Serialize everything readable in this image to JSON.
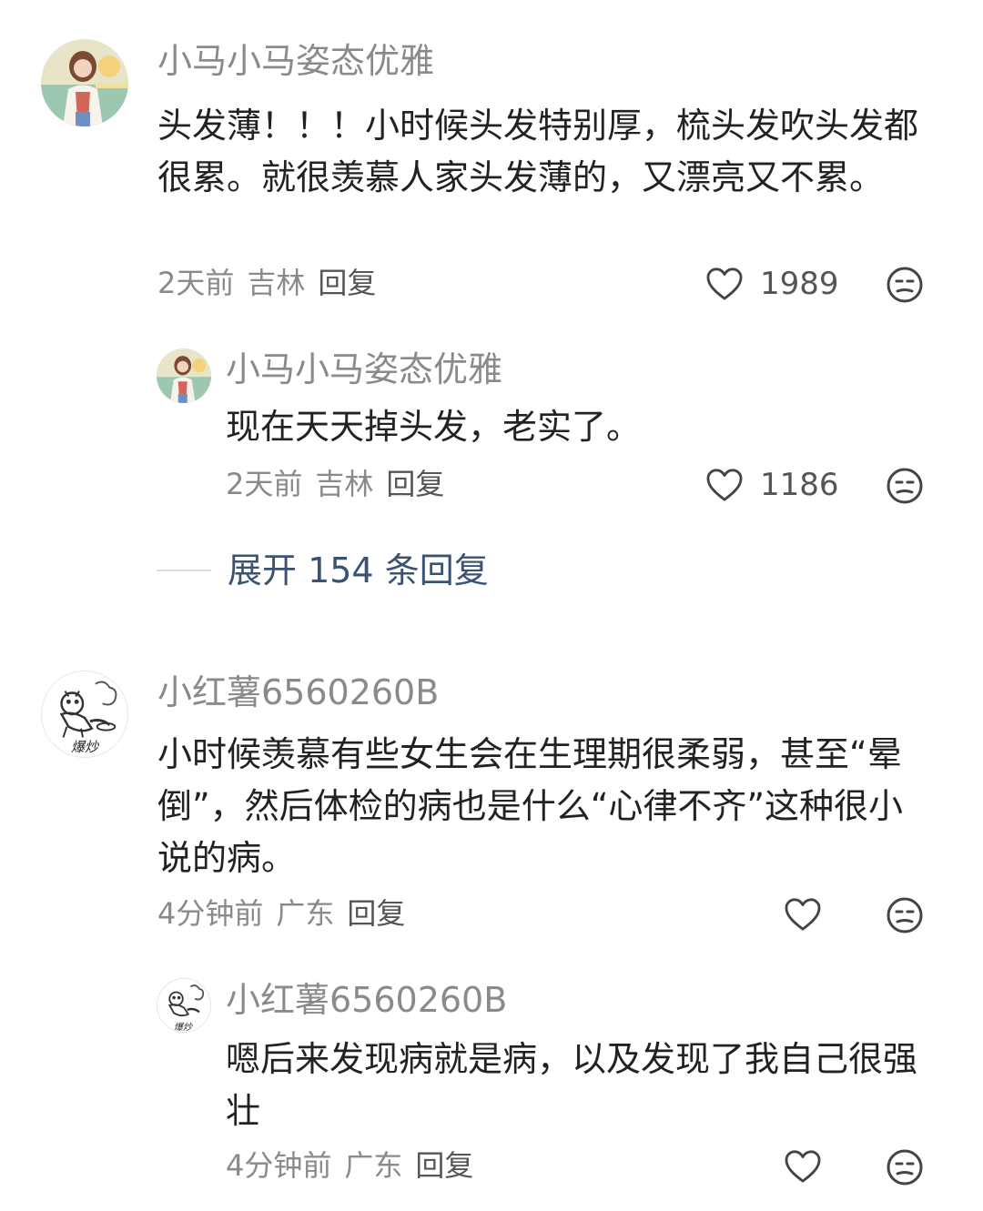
{
  "comments": [
    {
      "username": "小马小马姿态优雅",
      "text": "头发薄！！！小时候头发特别厚，梳头发吹头发都很累。就很羡慕人家头发薄的，又漂亮又不累。",
      "time": "2天前",
      "location": "吉林",
      "reply_label": "回复",
      "likes": "1989",
      "avatar": "girl-avatar",
      "reply": {
        "username": "小马小马姿态优雅",
        "text": "现在天天掉头发，老实了。",
        "time": "2天前",
        "location": "吉林",
        "reply_label": "回复",
        "likes": "1186",
        "avatar": "girl-avatar"
      },
      "expand_label": "展开 154 条回复"
    },
    {
      "username": "小红薯6560260B",
      "text": "小时候羡慕有些女生会在生理期很柔弱，甚至“晕倒”，然后体检的病也是什么“心律不齐”这种很小说的病。",
      "time": "4分钟前",
      "location": "广东",
      "reply_label": "回复",
      "likes": "",
      "avatar": "sketch-avatar",
      "avatar_caption": "爆炒",
      "reply": {
        "username": "小红薯6560260B",
        "text": "嗯后来发现病就是病，以及发现了我自己很强壮",
        "time": "4分钟前",
        "location": "广东",
        "reply_label": "回复",
        "likes": "",
        "avatar": "sketch-avatar",
        "avatar_caption": "爆炒"
      }
    }
  ],
  "colors": {
    "meta": "#8a8a8a",
    "text": "#222222",
    "expand": "#3b5373"
  }
}
